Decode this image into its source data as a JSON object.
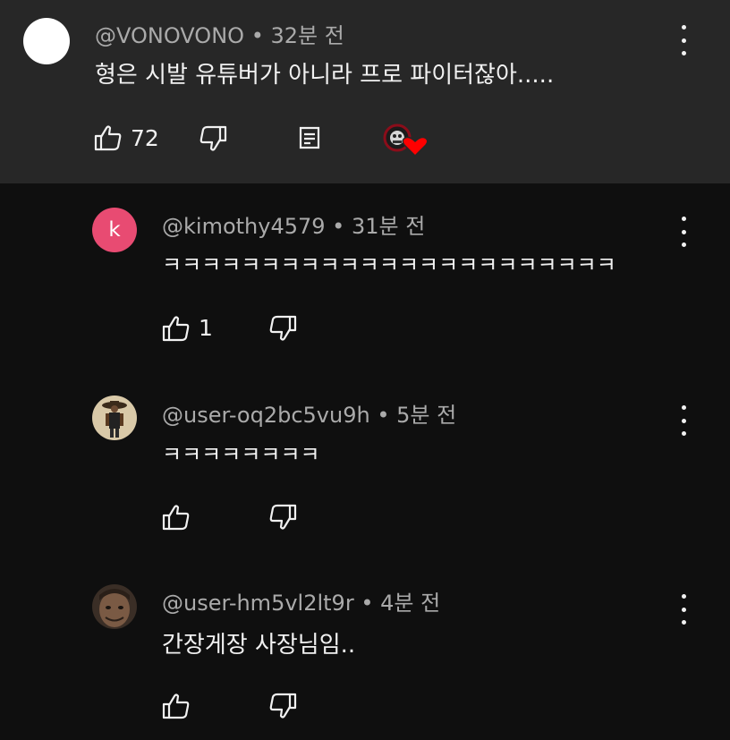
{
  "comments": [
    {
      "handle": "@VONOVONO",
      "sep": "•",
      "time": "32분 전",
      "text": "형은 시발 유튜버가 아니라 프로 파이터잖아.....",
      "like_count": "72"
    },
    {
      "avatar_letter": "k",
      "handle": "@kimothy4579",
      "sep": "•",
      "time": "31분 전",
      "text": "ㅋㅋㅋㅋㅋㅋㅋㅋㅋㅋㅋㅋㅋㅋㅋㅋㅋㅋㅋㅋㅋㅋㅋ",
      "like_count": "1"
    },
    {
      "handle": "@user-oq2bc5vu9h",
      "sep": "•",
      "time": "5분 전",
      "text": "ㅋㅋㅋㅋㅋㅋㅋㅋ"
    },
    {
      "handle": "@user-hm5vl2lt9r",
      "sep": "•",
      "time": "4분 전",
      "text": "간장게장 사장님임.."
    }
  ],
  "colors": {
    "top_bg": "#272727",
    "page_bg": "#0f0f0f",
    "heart": "#ff0000",
    "pink_avatar": "#e84b72"
  }
}
